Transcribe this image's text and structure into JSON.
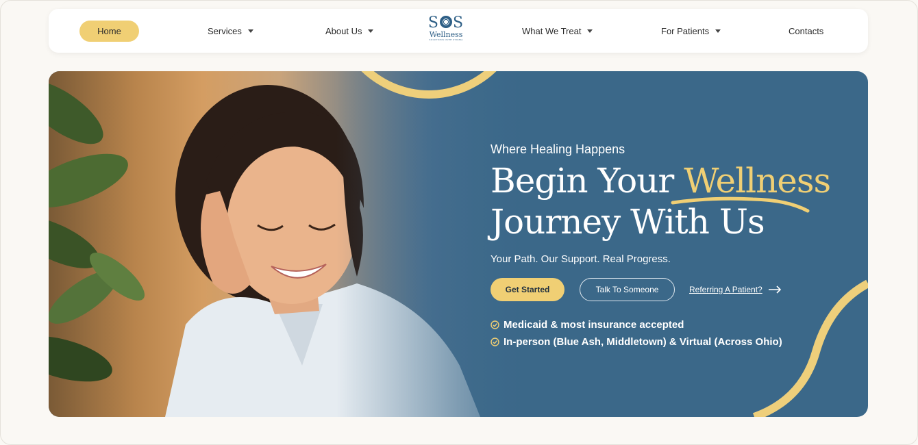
{
  "nav": {
    "home": "Home",
    "items": [
      {
        "label": "Services",
        "dropdown": true
      },
      {
        "label": "About Us",
        "dropdown": true
      },
      {
        "label": "What We Treat",
        "dropdown": true
      },
      {
        "label": "For Patients",
        "dropdown": true
      },
      {
        "label": "Contacts",
        "dropdown": false
      }
    ],
    "logo": {
      "title": "SOS",
      "subtitle": "Wellness",
      "tagline": "SOLUTIONS OVER STIGMA"
    }
  },
  "hero": {
    "eyebrow": "Where Healing Happens",
    "headline_part1": "Begin Your ",
    "headline_highlight": "Wellness",
    "headline_part2": "Journey With Us",
    "subline": "Your Path. Our Support. Real Progress.",
    "cta_primary": "Get Started",
    "cta_secondary": "Talk To Someone",
    "cta_link": "Referring A Patient?",
    "features": [
      "Medicaid & most insurance accepted",
      "In-person (Blue Ash, Middletown) & Virtual (Across Ohio)"
    ],
    "photo": "smiling-woman-photo"
  },
  "colors": {
    "accent": "#f0cf74",
    "hero_bg": "#3b6889",
    "logo_blue": "#2e5f86"
  }
}
